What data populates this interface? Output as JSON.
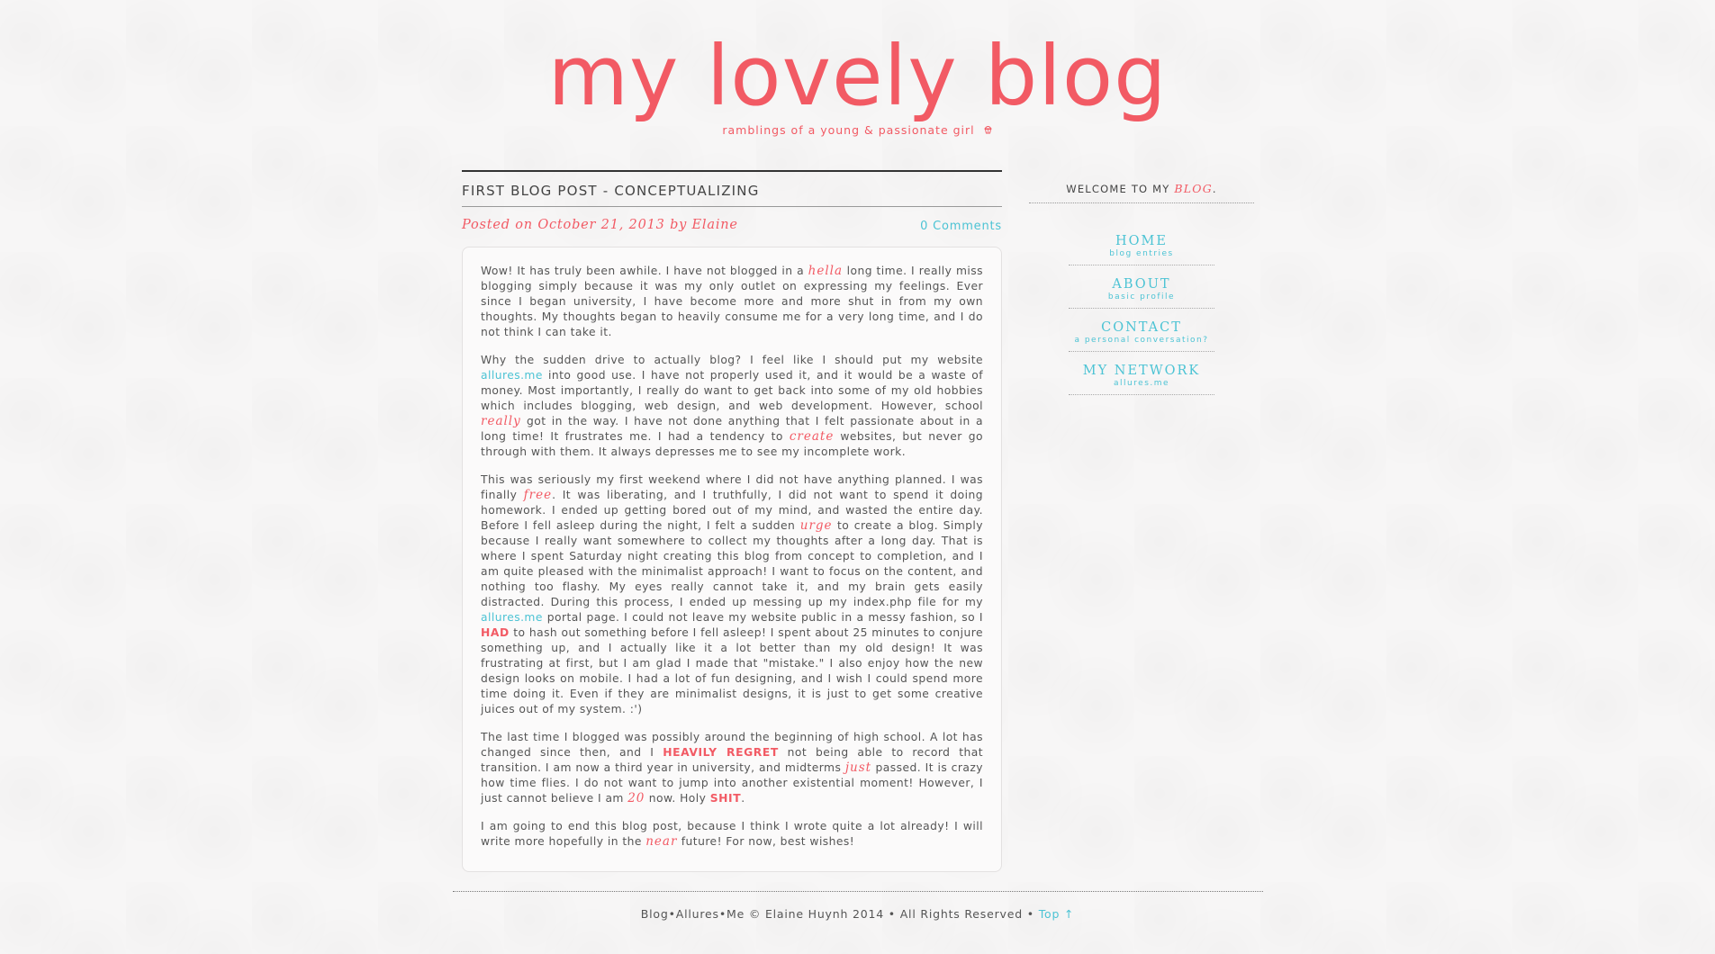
{
  "header": {
    "title": "my lovely blog",
    "tagline": "ramblings of a young & passionate girl",
    "tagline_icon": "cupcake-icon"
  },
  "post": {
    "title": "FIRST BLOG POST - CONCEPTUALIZING",
    "byline": "Posted on October 21, 2013 by Elaine",
    "comments": "0 Comments",
    "p1": {
      "a": "Wow! It has truly been awhile. I have not blogged in a ",
      "em1": "hella",
      "b": " long time. I really miss blogging simply because it was my only outlet on expressing my feelings. Ever since I began university, I have become more and more shut in from my own thoughts. My thoughts began to heavily consume me for a very long time, and I do not think I can take it."
    },
    "p2": {
      "a": "Why the sudden drive to actually blog? I feel like I should put my website ",
      "link1": "allures.me",
      "b": " into good use. I have not properly used it, and it would be a waste of money. Most importantly, I really do want to get back into some of my old hobbies which includes blogging, web design, and web development. However, school ",
      "em1": "really",
      "c": " got in the way. I have not done anything that I felt passionate about in a long time! It frustrates me. I had a tendency to ",
      "em2": "create",
      "d": " websites, but never go through with them. It always depresses me to see my incomplete work."
    },
    "p3": {
      "a": "This was seriously my first weekend where I did not have anything planned. I was finally ",
      "em1": "free",
      "b": ". It was liberating, and I truthfully, I did not want to spend it doing homework. I ended up getting bored out of my mind, and wasted the entire day. Before I fell asleep during the night, I felt a sudden ",
      "em2": "urge",
      "c": " to create a blog. Simply because I really want somewhere to collect my thoughts after a long day. That is where I spent Saturday night creating this blog from concept to completion, and I am quite pleased with the minimalist approach! I want to focus on the content, and nothing too flashy. My eyes really cannot take it, and my brain gets easily distracted. During this process, I ended up messing up my index.php file for my ",
      "link1": "allures.me",
      "d": " portal page. I could not leave my website public in a messy fashion, so I ",
      "strong1": "HAD",
      "e": " to hash out something before I fell asleep! I spent about 25 minutes to conjure something up, and I actually like it a lot better than my old design! It was frustrating at first, but I am glad I made that \"mistake.\" I also enjoy how the new design looks on mobile. I had a lot of fun designing, and I wish I could spend more time doing it. Even if they are minimalist designs, it is just to get some creative juices out of my system. :')"
    },
    "p4": {
      "a": "The last time I blogged was possibly around the beginning of high school. A lot has changed since then, and I ",
      "strong1": "HEAVILY REGRET",
      "b": " not being able to record that transition. I am now a third year in university, and midterms ",
      "em1": "just",
      "c": " passed. It is crazy how time flies. I do not want to jump into another existential moment! However, I just cannot believe I am ",
      "em2": "20",
      "d": " now. Holy ",
      "strong2": "SHIT",
      "e": "."
    },
    "p5": {
      "a": "I am going to end this blog post, because I think I wrote quite a lot already! I will write more hopefully in the ",
      "em1": "near",
      "b": " future! For now, best wishes!"
    }
  },
  "sidebar": {
    "welcome_prefix": "WELCOME TO MY ",
    "welcome_emph": "BLOG",
    "welcome_suffix": ".",
    "nav": [
      {
        "label": "HOME",
        "sub": "blog entries"
      },
      {
        "label": "ABOUT",
        "sub": "basic profile"
      },
      {
        "label": "CONTACT",
        "sub": "a personal conversation?"
      },
      {
        "label": "MY NETWORK",
        "sub": "allures.me"
      }
    ]
  },
  "footer": {
    "text": "Blog•Allures•Me © Elaine Huynh 2014 • All Rights Reserved • ",
    "top_link": "Top ↑"
  },
  "colors": {
    "accent": "#f25a64",
    "link": "#4cc3d4",
    "text": "#555555"
  }
}
